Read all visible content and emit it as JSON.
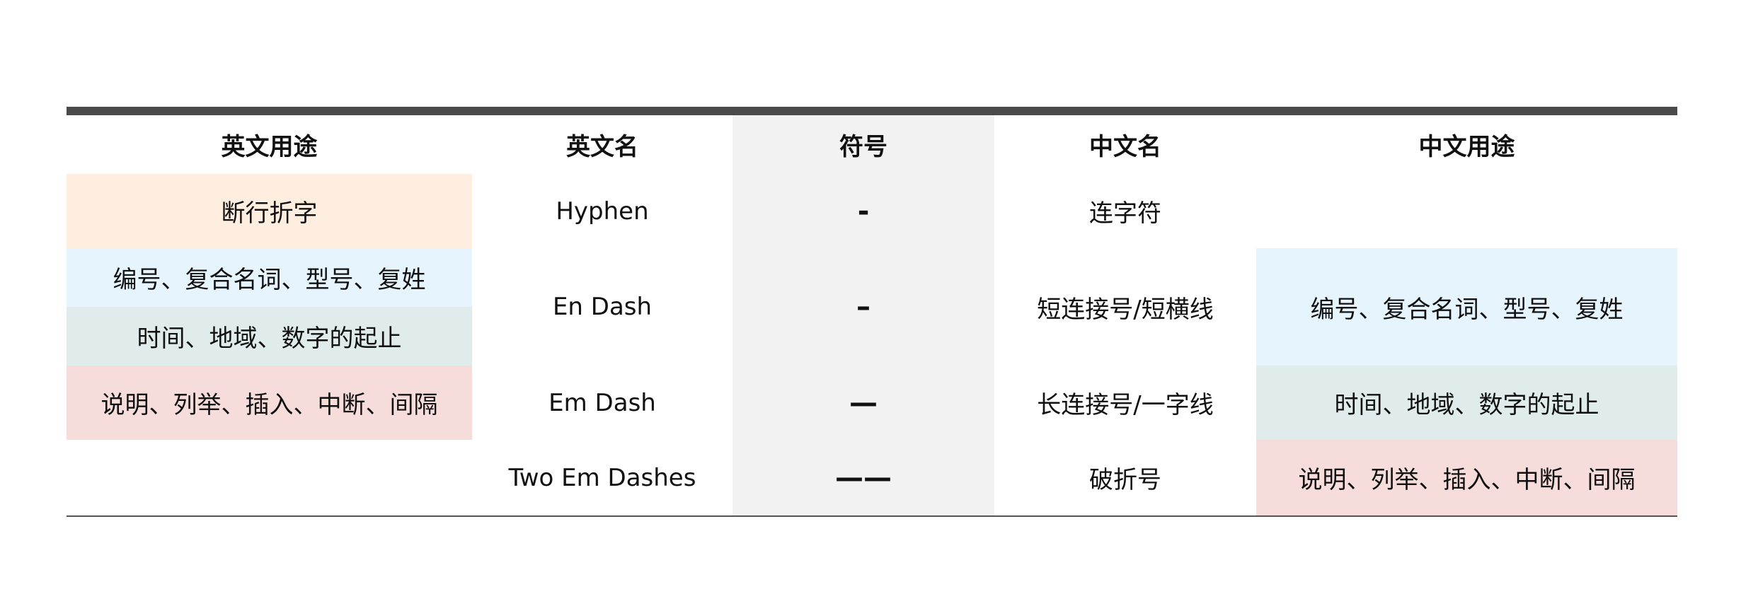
{
  "headers": {
    "en_usage": "英文用途",
    "en_name": "英文名",
    "symbol": "符号",
    "cn_name": "中文名",
    "cn_usage": "中文用途"
  },
  "colors": {
    "peach": "#fdeee0",
    "blue": "#e6f4fd",
    "teal": "#dfeceb",
    "pink": "#f6dcda",
    "symbol_column": "#f2f2f2",
    "rule": "#4a4a4a"
  },
  "en_usage": [
    {
      "text": "断行折字",
      "color": "peach"
    },
    {
      "text": "编号、复合名词、型号、复姓",
      "color": "blue"
    },
    {
      "text": "时间、地域、数字的起止",
      "color": "teal"
    },
    {
      "text": "说明、列举、插入、中断、间隔",
      "color": "pink"
    }
  ],
  "rows": [
    {
      "en_name": "Hyphen",
      "symbol": "-",
      "cn_name": "连字符",
      "cn_usage": ""
    },
    {
      "en_name": "En Dash",
      "symbol": "–",
      "cn_name": "短连接号/短横线",
      "cn_usage": "编号、复合名词、型号、复姓"
    },
    {
      "en_name": "Em Dash",
      "symbol": "—",
      "cn_name": "长连接号/一字线",
      "cn_usage": "时间、地域、数字的起止"
    },
    {
      "en_name": "Two Em Dashes",
      "symbol": "——",
      "cn_name": "破折号",
      "cn_usage": "说明、列举、插入、中断、间隔"
    }
  ]
}
